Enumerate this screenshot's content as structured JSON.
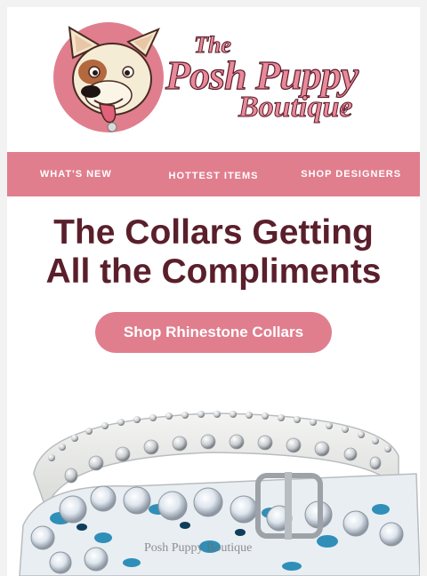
{
  "brand": {
    "logo_line1": "The",
    "logo_line2": "Posh Puppy",
    "logo_line3": "Boutique",
    "logo_mark": "®",
    "accent_color": "#e07e8e",
    "headline_color": "#5a1f2b"
  },
  "nav": {
    "items": [
      {
        "label": "WHAT'S NEW"
      },
      {
        "label": "HOTTEST ITEMS"
      },
      {
        "label": "SHOP DESIGNERS"
      }
    ]
  },
  "hero": {
    "headline_line1": "The Collars Getting",
    "headline_line2": "All the Compliments",
    "cta_label": "Shop Rhinestone Collars"
  },
  "product_image": {
    "watermark": "Posh Puppy Boutique",
    "icon": "rhinestone-collar-photo"
  }
}
